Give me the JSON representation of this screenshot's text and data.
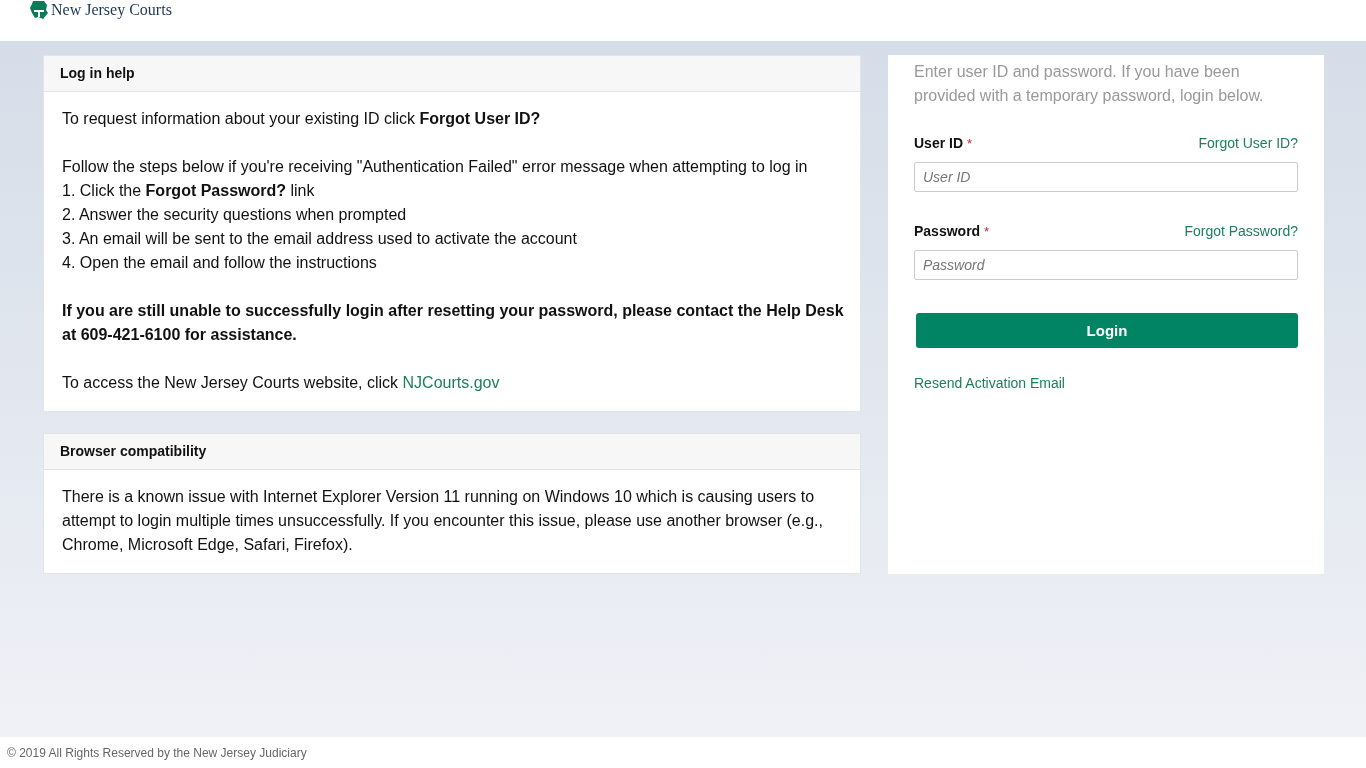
{
  "header": {
    "logo_text": "New Jersey Courts"
  },
  "help_panels": [
    {
      "title": "Log in help",
      "blocks": [
        {
          "kind": "text",
          "text": "To request information about your existing ID click **Forgot User ID?**"
        },
        {
          "kind": "steps",
          "intro": "Follow the steps below if you're receiving \"Authentication Failed\" error message when attempting to log in",
          "steps": [
            "1. Click the **Forgot Password?** link",
            "2. Answer the security questions when prompted",
            "3. An email will be sent to the email address used to activate the account",
            "4. Open the email and follow the instructions"
          ]
        },
        {
          "kind": "notice",
          "text": "If you are still unable to successfully login after resetting your password, please contact the Help Desk at 609-421-6100 for assistance."
        },
        {
          "kind": "link",
          "text": "To access the New Jersey Courts website, click",
          "link": "NJCourts.gov"
        }
      ]
    },
    {
      "title": "Browser compatibility",
      "blocks": [
        {
          "kind": "text",
          "text": "There is a known issue with Internet Explorer Version 11 running on Windows 10 which is causing users to attempt to login multiple times unsuccessfully. If you encounter this issue, please use another browser (e.g., Chrome, Microsoft Edge, Safari, Firefox)."
        }
      ]
    }
  ],
  "login": {
    "intro": "Enter user ID and password. If you have been provided with a temporary password, login below.",
    "fields": [
      {
        "label": "User ID",
        "required_mark": "*",
        "link": "Forgot User ID?",
        "placeholder": "User ID"
      },
      {
        "label": "Password",
        "required_mark": "*",
        "link": "Forgot Password?",
        "placeholder": "Password"
      }
    ],
    "button": "Login",
    "link": "Resend Activation Email"
  },
  "footer": {
    "text": "© 2019 All Rights Reserved by the New Jersey Judiciary"
  }
}
